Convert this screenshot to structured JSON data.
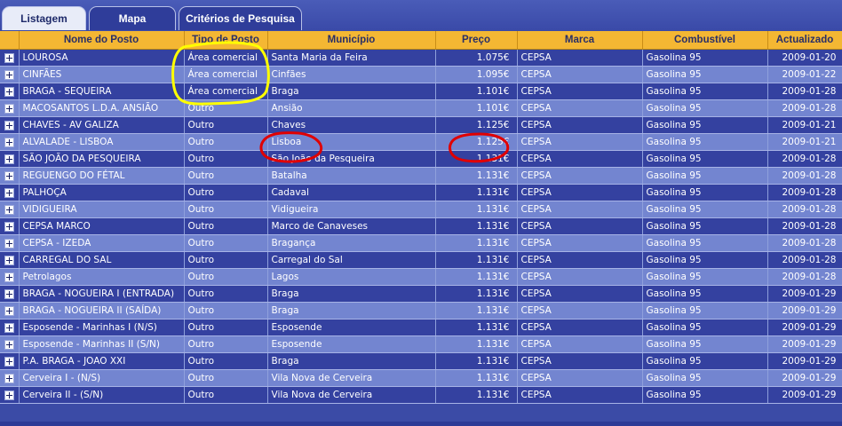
{
  "tabs": [
    "Listagem",
    "Mapa",
    "Critérios de Pesquisa"
  ],
  "columns": [
    "Nome do Posto",
    "Tipo de Posto",
    "Município",
    "Preço",
    "Marca",
    "Combustível",
    "Actualizado"
  ],
  "rows": [
    [
      "LOUROSA",
      "Área comercial",
      "Santa Maria da Feira",
      "1.075€",
      "CEPSA",
      "Gasolina 95",
      "2009-01-20"
    ],
    [
      "CINFÃES",
      "Área comercial",
      "Cinfães",
      "1.095€",
      "CEPSA",
      "Gasolina 95",
      "2009-01-22"
    ],
    [
      "BRAGA - SEQUEIRA",
      "Área comercial",
      "Braga",
      "1.101€",
      "CEPSA",
      "Gasolina 95",
      "2009-01-28"
    ],
    [
      "MACOSANTOS L.D.A. ANSIÃO",
      "Outro",
      "Ansião",
      "1.101€",
      "CEPSA",
      "Gasolina 95",
      "2009-01-28"
    ],
    [
      "CHAVES - AV GALIZA",
      "Outro",
      "Chaves",
      "1.125€",
      "CEPSA",
      "Gasolina 95",
      "2009-01-21"
    ],
    [
      "ALVALADE - LISBOA",
      "Outro",
      "Lisboa",
      "1.125€",
      "CEPSA",
      "Gasolina 95",
      "2009-01-21"
    ],
    [
      "SÃO JOÃO DA PESQUEIRA",
      "Outro",
      "São João da Pesqueira",
      "1.131€",
      "CEPSA",
      "Gasolina 95",
      "2009-01-28"
    ],
    [
      "REGUENGO DO FÉTAL",
      "Outro",
      "Batalha",
      "1.131€",
      "CEPSA",
      "Gasolina 95",
      "2009-01-28"
    ],
    [
      "PALHOÇA",
      "Outro",
      "Cadaval",
      "1.131€",
      "CEPSA",
      "Gasolina 95",
      "2009-01-28"
    ],
    [
      "VIDIGUEIRA",
      "Outro",
      "Vidigueira",
      "1.131€",
      "CEPSA",
      "Gasolina 95",
      "2009-01-28"
    ],
    [
      "CEPSA MARCO",
      "Outro",
      "Marco de Canaveses",
      "1.131€",
      "CEPSA",
      "Gasolina 95",
      "2009-01-28"
    ],
    [
      "CEPSA - IZEDA",
      "Outro",
      "Bragança",
      "1.131€",
      "CEPSA",
      "Gasolina 95",
      "2009-01-28"
    ],
    [
      "CARREGAL DO SAL",
      "Outro",
      "Carregal do Sal",
      "1.131€",
      "CEPSA",
      "Gasolina 95",
      "2009-01-28"
    ],
    [
      "Petrolagos",
      "Outro",
      "Lagos",
      "1.131€",
      "CEPSA",
      "Gasolina 95",
      "2009-01-28"
    ],
    [
      "BRAGA - NOGUEIRA I (ENTRADA)",
      "Outro",
      "Braga",
      "1.131€",
      "CEPSA",
      "Gasolina 95",
      "2009-01-29"
    ],
    [
      "BRAGA - NOGUEIRA II (SAÍDA)",
      "Outro",
      "Braga",
      "1.131€",
      "CEPSA",
      "Gasolina 95",
      "2009-01-29"
    ],
    [
      "Esposende - Marinhas I (N/S)",
      "Outro",
      "Esposende",
      "1.131€",
      "CEPSA",
      "Gasolina 95",
      "2009-01-29"
    ],
    [
      "Esposende - Marinhas II (S/N)",
      "Outro",
      "Esposende",
      "1.131€",
      "CEPSA",
      "Gasolina 95",
      "2009-01-29"
    ],
    [
      "P.A. BRAGA - JOAO XXI",
      "Outro",
      "Braga",
      "1.131€",
      "CEPSA",
      "Gasolina 95",
      "2009-01-29"
    ],
    [
      "Cerveira I - (N/S)",
      "Outro",
      "Vila Nova de Cerveira",
      "1.131€",
      "CEPSA",
      "Gasolina 95",
      "2009-01-29"
    ],
    [
      "Cerveira II - (S/N)",
      "Outro",
      "Vila Nova de Cerveira",
      "1.131€",
      "CEPSA",
      "Gasolina 95",
      "2009-01-29"
    ]
  ],
  "colors": {
    "header_bg": "#f4b733",
    "row_dark": "#3441a0",
    "row_light": "#7385d0",
    "annotation_yellow": "#ffff00",
    "annotation_red": "#e00000"
  }
}
